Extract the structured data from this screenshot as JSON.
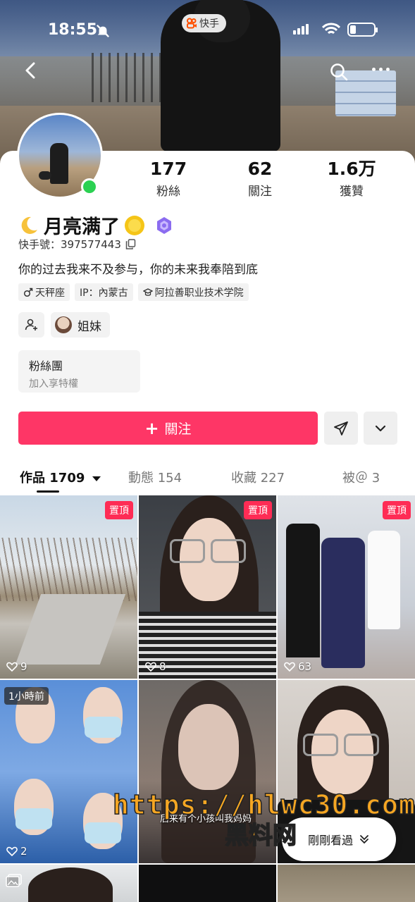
{
  "status_bar": {
    "time": "18:55",
    "app_label": "快手"
  },
  "profile": {
    "stats": [
      {
        "value": "177",
        "label": "粉絲"
      },
      {
        "value": "62",
        "label": "關注"
      },
      {
        "value": "1.6万",
        "label": "獲贊"
      }
    ],
    "name": "月亮满了",
    "kuaishou_id": "快手號：397577443",
    "bio": "你的过去我来不及参与，你的未来我奉陪到底",
    "tags": [
      {
        "icon": "male-icon",
        "label": "天秤座"
      },
      {
        "icon": "",
        "label": "IP：內蒙古"
      },
      {
        "icon": "graduation-cap-icon",
        "label": "阿拉善职业技术学院"
      }
    ],
    "relation_label": "姐妹",
    "fan_club": {
      "title": "粉絲團",
      "subtitle": "加入享特權"
    },
    "follow_label": "關注"
  },
  "tabs": [
    {
      "label": "作品",
      "count": "1709",
      "active": true
    },
    {
      "label": "動態",
      "count": "154",
      "active": false
    },
    {
      "label": "收藏",
      "count": "227",
      "active": false
    },
    {
      "label": "被＠",
      "count": "3",
      "active": false
    }
  ],
  "grid": {
    "pin_label": "置頂",
    "recent_label": "1小時前",
    "items": [
      {
        "likes": "9"
      },
      {
        "likes": "8"
      },
      {
        "likes": "63"
      },
      {
        "likes": "2"
      },
      {
        "likes": ""
      },
      {
        "likes": ""
      }
    ],
    "caption": "后来有个小孩叫我妈妈"
  },
  "recently_watched_label": "剛剛看過",
  "watermark": {
    "url": "https://hlwc30.com",
    "brand": "黑料网"
  },
  "colors": {
    "accent": "#fe3666",
    "pin": "#fe2c55",
    "online": "#2bd152"
  }
}
